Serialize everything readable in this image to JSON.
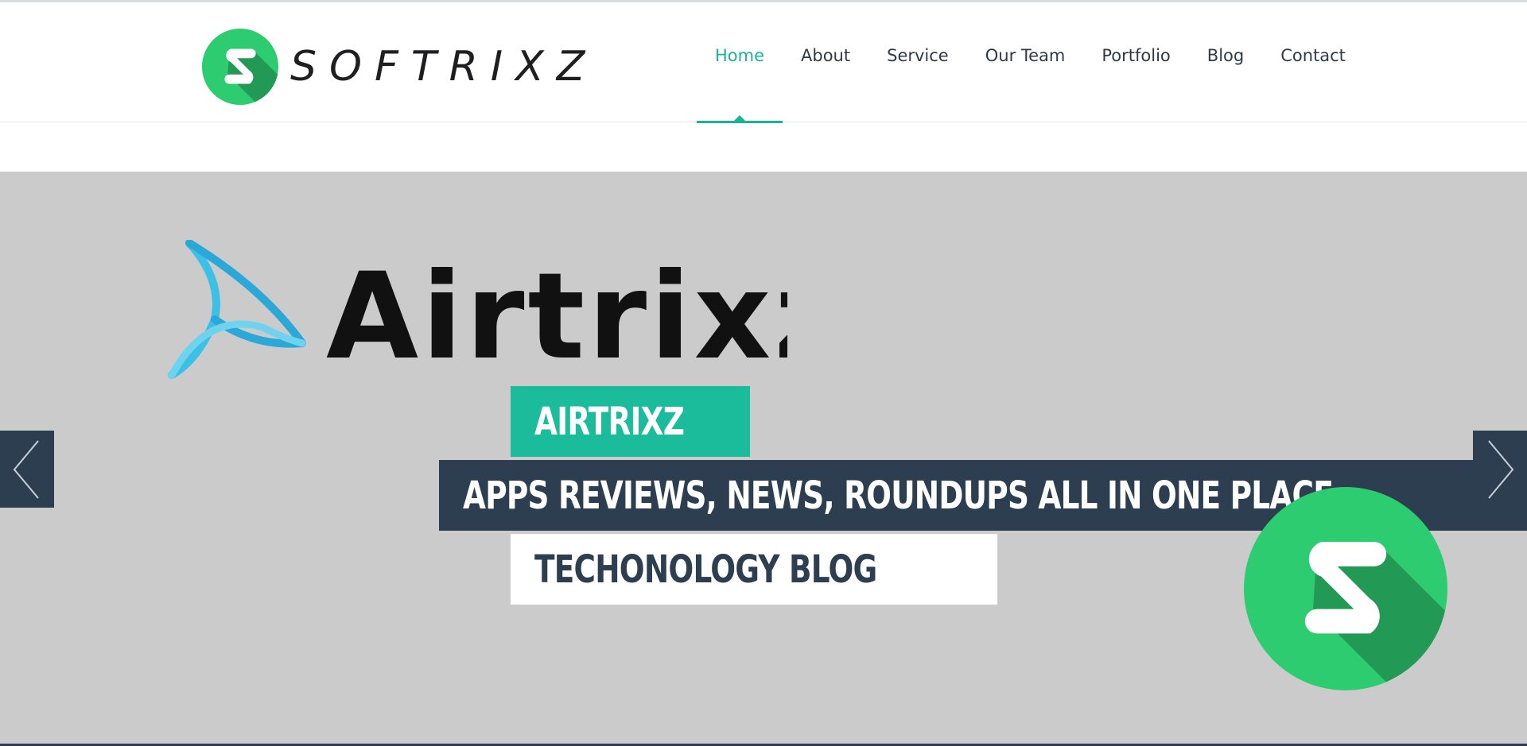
{
  "brand": {
    "name": "SOFTRIXZ",
    "accent_color": "#1ab394",
    "logo_green": "#2ecc71",
    "logo_shadow": "#229a55"
  },
  "nav": {
    "items": [
      {
        "label": "Home",
        "active": true
      },
      {
        "label": "About"
      },
      {
        "label": "Service"
      },
      {
        "label": "Our Team"
      },
      {
        "label": "Portfolio"
      },
      {
        "label": "Blog"
      },
      {
        "label": "Contact"
      }
    ]
  },
  "hero": {
    "background": "#cbcbcb",
    "slide_logo_text": "Airtrixz",
    "caption_title": "AIRTRIXZ",
    "caption_subtitle": "APPS REVIEWS, NEWS, ROUNDUPS ALL IN ONE PLACE.",
    "caption_tag": "TECHONOLOGY BLOG",
    "prev_icon": "chevron-left-icon",
    "next_icon": "chevron-right-icon",
    "dark_color": "#2c3e50",
    "teal_color": "#1abc9c"
  }
}
